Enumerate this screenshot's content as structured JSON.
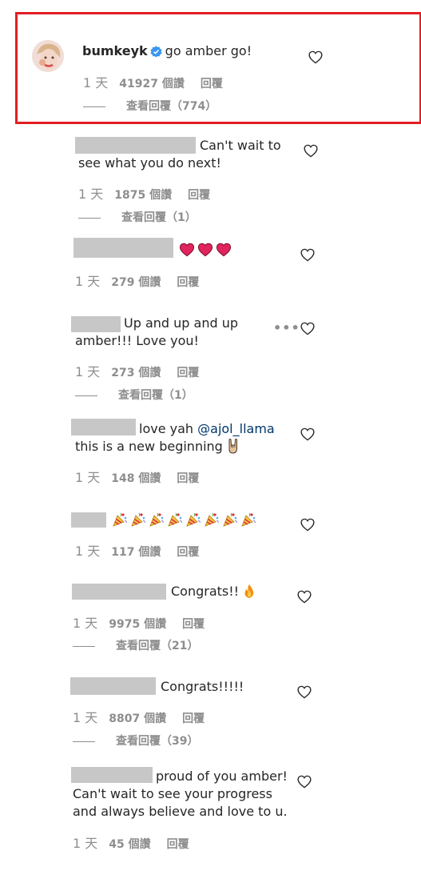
{
  "highlighted_comment": {
    "username": "bumkeyk",
    "text": "go amber go!",
    "time": "1 天",
    "likes": "41927 個讚",
    "reply_label": "回覆",
    "view_replies": "查看回覆（774）"
  },
  "comments": [
    {
      "line1": "Can't wait to",
      "line2": "see what you do next!",
      "time": "1 天",
      "likes": "1875 個讚",
      "reply_label": "回覆",
      "view_replies": "查看回覆（1）"
    },
    {
      "emoji": [
        "heart-emoji",
        "heart-emoji",
        "heart-emoji"
      ],
      "time": "1 天",
      "likes": "279 個讚",
      "reply_label": "回覆"
    },
    {
      "line1": "Up and up and up",
      "line2": "amber!!! Love you!",
      "time": "1 天",
      "likes": "273 個讚",
      "reply_label": "回覆",
      "view_replies": "查看回覆（1）"
    },
    {
      "line1_prefix": "love yah ",
      "mention": "@ajol_llama",
      "line2": "this is a new beginning",
      "emoji_after": "rock-hand-emoji",
      "time": "1 天",
      "likes": "148 個讚",
      "reply_label": "回覆"
    },
    {
      "emoji": [
        "party-popper-emoji",
        "party-popper-emoji",
        "party-popper-emoji",
        "party-popper-emoji",
        "party-popper-emoji",
        "party-popper-emoji",
        "party-popper-emoji",
        "party-popper-emoji"
      ],
      "time": "1 天",
      "likes": "117 個讚",
      "reply_label": "回覆"
    },
    {
      "line1": "Congrats!!",
      "emoji_after": "fire-emoji",
      "time": "1 天",
      "likes": "9975 個讚",
      "reply_label": "回覆",
      "view_replies": "查看回覆（21）"
    },
    {
      "line1": "Congrats!!!!!",
      "time": "1 天",
      "likes": "8807 個讚",
      "reply_label": "回覆",
      "view_replies": "查看回覆（39）"
    },
    {
      "line1": "proud of you amber!",
      "line2": "Can't wait to see your progress",
      "line3": "and always believe and love to u.",
      "time": "1 天",
      "likes": "45 個讚",
      "reply_label": "回覆"
    }
  ],
  "icons": {
    "like": "heart-outline-icon",
    "more": "more-options-icon",
    "verified": "verified-badge-icon"
  },
  "colors": {
    "highlight_border": "#e31e24",
    "verified": "#3897f0",
    "mention": "#00376b",
    "muted": "#8e8e8e",
    "redaction": "#c7c7c7"
  }
}
